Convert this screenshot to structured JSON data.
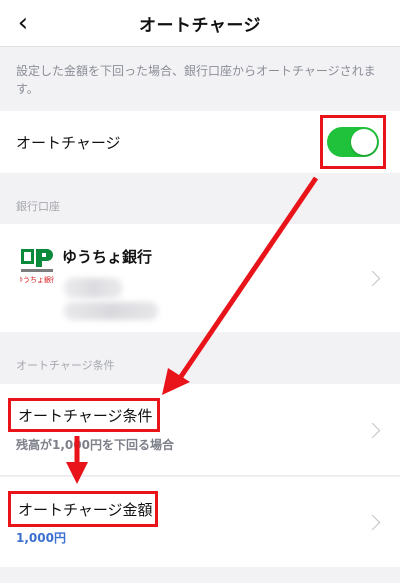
{
  "header": {
    "title": "オートチャージ",
    "back_icon": "chevron-left-icon"
  },
  "note": "設定した金額を下回った場合、銀行口座からオートチャージされます。",
  "auto_charge": {
    "label": "オートチャージ",
    "enabled": true,
    "toggle_color": "#21c23b"
  },
  "bank_section": {
    "label": "銀行口座",
    "bank_name": "ゆうちょ銀行",
    "logo_caption": "ゆうちょ銀行"
  },
  "conditions_section": {
    "label": "オートチャージ条件",
    "condition": {
      "label": "オートチャージ条件",
      "value": "残高が1,000円を下回る場合"
    },
    "amount": {
      "label": "オートチャージ金額",
      "value": "1,000円"
    }
  },
  "annotation_color": "#e8141a"
}
